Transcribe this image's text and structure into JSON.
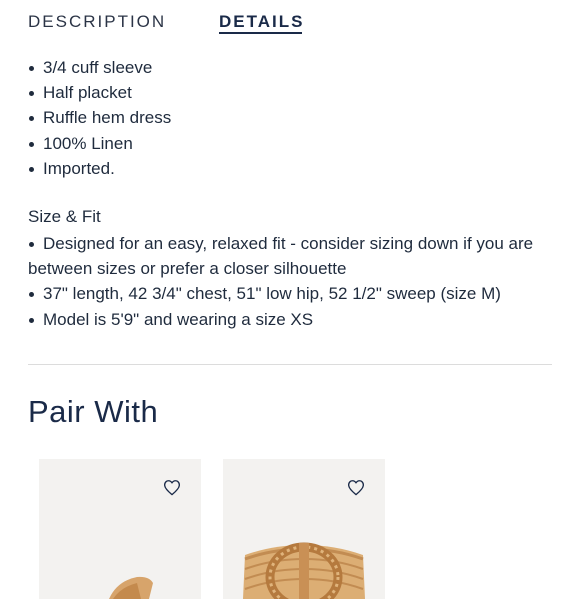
{
  "tabs": {
    "description_label": "DESCRIPTION",
    "details_label": "DETAILS",
    "active": "details"
  },
  "details": {
    "bullets": [
      "3/4 cuff sleeve",
      "Half placket",
      "Ruffle hem dress",
      "100% Linen",
      "Imported."
    ],
    "fit_heading": "Size & Fit",
    "fit_bullets": [
      "Designed for an easy, relaxed fit - consider sizing down if you are between sizes or prefer a closer silhouette",
      "37\" length, 42 3/4\" chest, 51\" low hip, 52 1/2\" sweep (size M)",
      "Model is 5'9\" and wearing a size XS"
    ]
  },
  "pair_with": {
    "title": "Pair With",
    "products": [
      {
        "image": "woven-straw-belt",
        "wishlist_icon": "heart-outline-icon"
      },
      {
        "image": "woven-straw-belt-buckle",
        "wishlist_icon": "heart-outline-icon"
      }
    ]
  },
  "colors": {
    "text": "#1f2b3d",
    "navy": "#1a2a48",
    "divider": "#dcdcdc",
    "card_bg": "#f3f2f0",
    "straw": "#d9a96b"
  }
}
